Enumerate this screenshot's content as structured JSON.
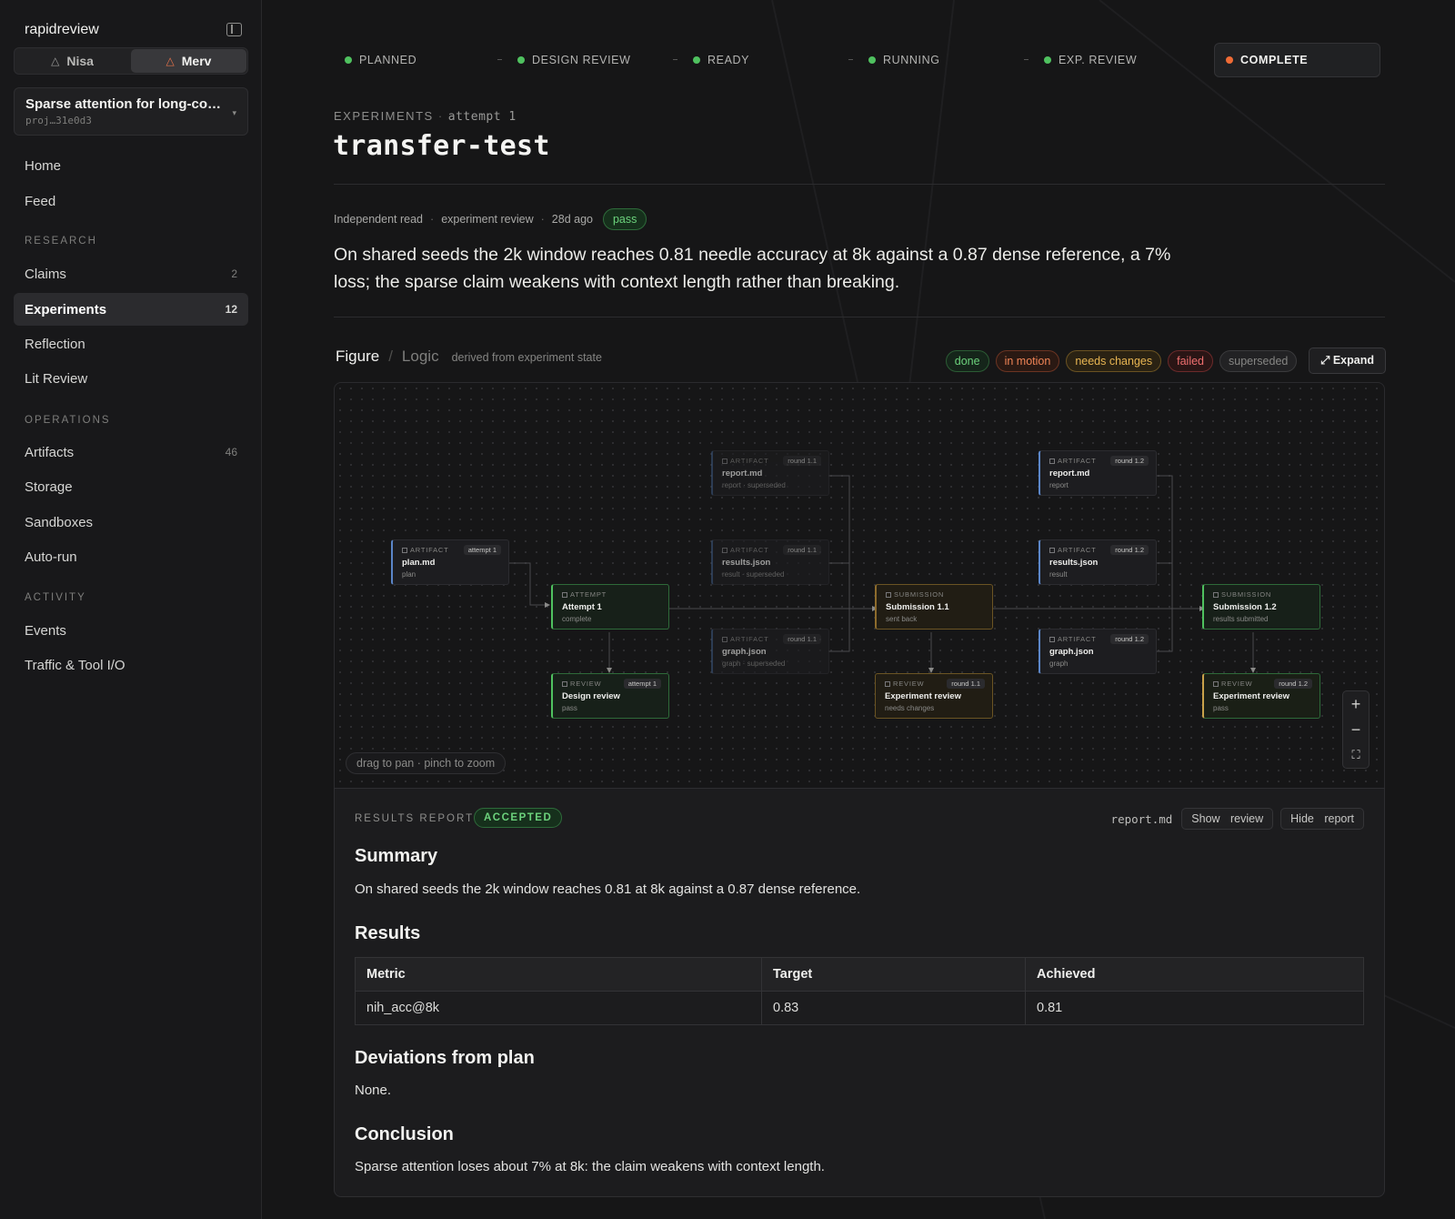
{
  "sidebar": {
    "brand": "rapidreview",
    "users": [
      {
        "name": "Nisa",
        "icon": "flask-icon"
      },
      {
        "name": "Merv",
        "icon": "flask-icon"
      }
    ],
    "project": {
      "title": "Sparse attention for long-co…",
      "id": "proj…31e0d3"
    },
    "top_items": [
      {
        "label": "Home"
      },
      {
        "label": "Feed"
      }
    ],
    "sections": [
      {
        "title": "RESEARCH",
        "items": [
          {
            "label": "Claims",
            "count": "2"
          },
          {
            "label": "Experiments",
            "count": "12",
            "active": true
          },
          {
            "label": "Reflection",
            "count": ""
          },
          {
            "label": "Lit Review",
            "count": ""
          }
        ]
      },
      {
        "title": "OPERATIONS",
        "items": [
          {
            "label": "Artifacts",
            "count": "46"
          },
          {
            "label": "Storage",
            "count": ""
          },
          {
            "label": "Sandboxes",
            "count": ""
          },
          {
            "label": "Auto-run",
            "count": ""
          }
        ]
      },
      {
        "title": "ACTIVITY",
        "items": [
          {
            "label": "Events",
            "count": ""
          },
          {
            "label": "Traffic & Tool I/O",
            "count": ""
          }
        ]
      }
    ]
  },
  "stepper": [
    {
      "label": "PLANNED",
      "state": "done"
    },
    {
      "label": "DESIGN REVIEW",
      "state": "done"
    },
    {
      "label": "READY",
      "state": "done"
    },
    {
      "label": "RUNNING",
      "state": "done"
    },
    {
      "label": "EXP. REVIEW",
      "state": "done"
    },
    {
      "label": "COMPLETE",
      "state": "current"
    }
  ],
  "header": {
    "section": "EXPERIMENTS",
    "attempt": "attempt 1",
    "title": "transfer-test"
  },
  "review": {
    "kind": "Independent read",
    "source": "experiment review",
    "age": "28d ago",
    "verdict_badge": "pass",
    "summary": "On shared seeds the 2k window reaches 0.81 needle accuracy at 8k against a 0.87 dense reference, a 7% loss; the sparse claim weakens with context length rather than breaking."
  },
  "figure": {
    "tab_figure": "Figure",
    "tab_logic": "Logic",
    "note": "derived from experiment state",
    "legend": [
      "done",
      "in motion",
      "needs changes",
      "failed",
      "superseded"
    ],
    "expand_label": "Expand",
    "hint": "drag to pan · pinch to zoom",
    "nodes": {
      "plan": {
        "kind": "ARTIFACT",
        "tag": "attempt 1",
        "title": "plan.md",
        "sub": "plan"
      },
      "attempt": {
        "kind": "ATTEMPT",
        "tag": "",
        "title": "Attempt 1",
        "sub": "complete"
      },
      "design_review": {
        "kind": "REVIEW",
        "tag": "attempt 1",
        "title": "Design review",
        "sub": "pass"
      },
      "report_11": {
        "kind": "ARTIFACT",
        "tag": "round 1.1",
        "title": "report.md",
        "sub": "report · superseded"
      },
      "results_11": {
        "kind": "ARTIFACT",
        "tag": "round 1.1",
        "title": "results.json",
        "sub": "result · superseded"
      },
      "graph_11": {
        "kind": "ARTIFACT",
        "tag": "round 1.1",
        "title": "graph.json",
        "sub": "graph · superseded"
      },
      "sub_11": {
        "kind": "SUBMISSION",
        "tag": "",
        "title": "Submission 1.1",
        "sub": "sent back"
      },
      "exp_review_11": {
        "kind": "REVIEW",
        "tag": "round 1.1",
        "title": "Experiment review",
        "sub": "needs changes"
      },
      "report_12": {
        "kind": "ARTIFACT",
        "tag": "round 1.2",
        "title": "report.md",
        "sub": "report"
      },
      "results_12": {
        "kind": "ARTIFACT",
        "tag": "round 1.2",
        "title": "results.json",
        "sub": "result"
      },
      "graph_12": {
        "kind": "ARTIFACT",
        "tag": "round 1.2",
        "title": "graph.json",
        "sub": "graph"
      },
      "sub_12": {
        "kind": "SUBMISSION",
        "tag": "",
        "title": "Submission 1.2",
        "sub": "results submitted"
      },
      "exp_review_12": {
        "kind": "REVIEW",
        "tag": "round 1.2",
        "title": "Experiment review",
        "sub": "pass"
      }
    }
  },
  "report": {
    "label": "RESULTS REPORT",
    "status": "ACCEPTED",
    "file": "report.md",
    "show_review": "Show review",
    "hide_report": "Hide report",
    "summary_h": "Summary",
    "summary": "On shared seeds the 2k window reaches 0.81 at 8k against a 0.87 dense reference.",
    "results_h": "Results",
    "table": {
      "headers": [
        "Metric",
        "Target",
        "Achieved"
      ],
      "rows": [
        [
          "nih_acc@8k",
          "0.83",
          "0.81"
        ]
      ]
    },
    "deviations_h": "Deviations from plan",
    "deviations": "None.",
    "conclusion_h": "Conclusion",
    "conclusion": "Sparse attention loses about 7% at 8k: the claim weakens with context length."
  },
  "colors": {
    "done": "#4fc15f",
    "current": "#ef6b35",
    "needs_changes": "#e7b552",
    "failed": "#ef6f6f",
    "artifact": "#5b86c8"
  }
}
